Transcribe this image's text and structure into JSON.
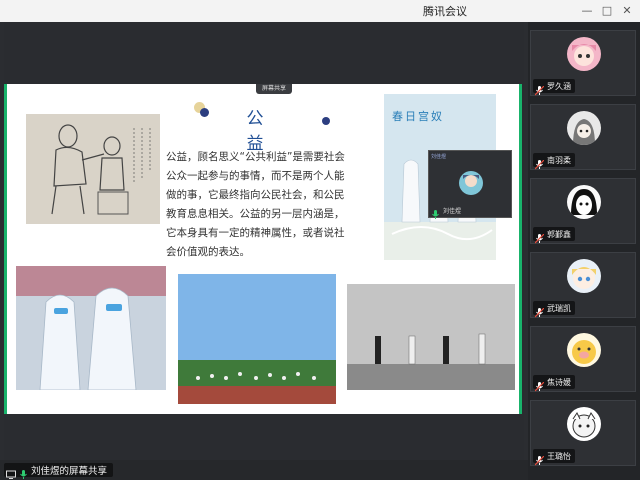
{
  "window": {
    "title": "腾讯会议"
  },
  "slide": {
    "share_tag": "屏幕共享",
    "title": "公 益",
    "body": "公益，顾名思义“公共利益”是需要社会公众一起参与的事情，而不是两个人能做的事，它最终指向公民社会，和公民教育息息相关。公益的另一层内涵是，它本身具有一定的精神属性，或者说社会价值观的表达。",
    "poster_caption": "春日宫奴",
    "colors": {
      "title": "#1f4e94",
      "accent_green": "#19b36b",
      "dot_navy": "#2c3e80",
      "dot_gold": "#c9a94e"
    }
  },
  "overlay_video": {
    "name": "刘佳煜",
    "label": "刘佳煜"
  },
  "participants": [
    {
      "name": "罗久涵",
      "avatar": "pink-anime-avatar"
    },
    {
      "name": "南羽柔",
      "avatar": "grey-hood-avatar"
    },
    {
      "name": "郭鄞鑫",
      "avatar": "sketch-face-avatar"
    },
    {
      "name": "武瑞凯",
      "avatar": "blonde-chibi-avatar"
    },
    {
      "name": "焦诗媛",
      "avatar": "yellow-pig-avatar"
    },
    {
      "name": "王璐怡",
      "avatar": "white-pup-avatar"
    }
  ],
  "status": {
    "share_label": "刘佳煜的屏幕共享",
    "mic_color": "#2ecc71"
  }
}
